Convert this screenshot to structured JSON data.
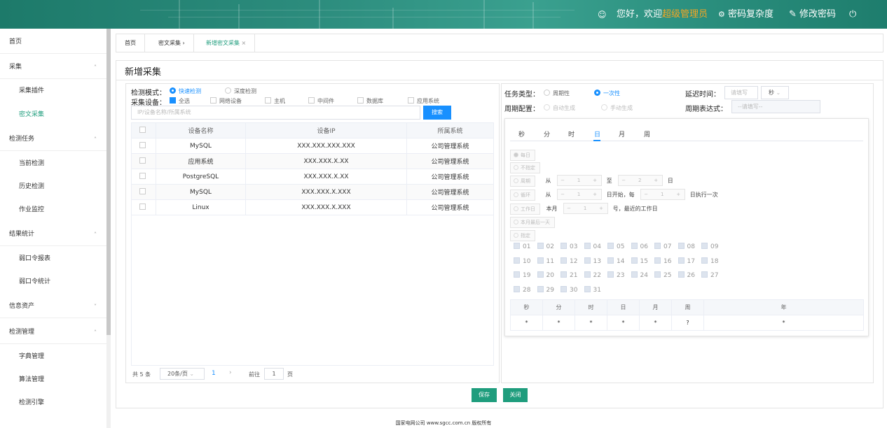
{
  "header": {
    "greeting": "您好，欢迎",
    "user_role": "超级管理员",
    "password_complexity": "密码复杂度",
    "change_password": "修改密码",
    "accent_color": "#f5a623",
    "icons": [
      "user-icon",
      "gear-icon",
      "edit-icon",
      "power-icon"
    ]
  },
  "sidebar": {
    "items": [
      {
        "label": "首页",
        "level": "top"
      },
      {
        "label": "采集",
        "level": "top",
        "arrow": "^"
      },
      {
        "label": "采集插件",
        "level": "sub"
      },
      {
        "label": "密文采集",
        "level": "sub",
        "active": true
      },
      {
        "label": "检测任务",
        "level": "top",
        "arrow": "^"
      },
      {
        "label": "当前检测",
        "level": "sub"
      },
      {
        "label": "历史检测",
        "level": "sub"
      },
      {
        "label": "作业监控",
        "level": "sub"
      },
      {
        "label": "结果统计",
        "level": "top",
        "arrow": "^"
      },
      {
        "label": "弱口令报表",
        "level": "sub"
      },
      {
        "label": "弱口令统计",
        "level": "sub"
      },
      {
        "label": "信息资产",
        "level": "top",
        "arrow": "v"
      },
      {
        "label": "检测管理",
        "level": "top",
        "arrow": "^"
      },
      {
        "label": "字典管理",
        "level": "sub"
      },
      {
        "label": "算法管理",
        "level": "sub"
      },
      {
        "label": "检测引擎",
        "level": "sub"
      }
    ],
    "active_color": "#1f9d7d"
  },
  "tabs": {
    "home": "首页",
    "cipher": "密文采集",
    "cipher_sep": "›",
    "new": "新增密文采集",
    "close": "×"
  },
  "panel": {
    "title": "新增采集"
  },
  "left": {
    "mode_label": "检测模式：",
    "mode_fast": "快速检测",
    "mode_deep": "深度检测",
    "device_label": "采集设备：",
    "device_options": [
      "全选",
      "网络设备",
      "主机",
      "中间件",
      "数据库",
      "应用系统"
    ],
    "search_placeholder": "IP/设备名称/所属系统",
    "search_button": "搜索",
    "table": {
      "headers": [
        "设备名称",
        "设备IP",
        "所属系统"
      ],
      "rows": [
        [
          "MySQL",
          "XXX.XXX.XXX.XXX",
          "公司管理系统"
        ],
        [
          "应用系统",
          "XXX.XXX.X.XX",
          "公司管理系统"
        ],
        [
          "PostgreSQL",
          "XXX.XXX.X.XX",
          "公司管理系统"
        ],
        [
          "MySQL",
          "XXX.XXX.X.XXX",
          "公司管理系统"
        ],
        [
          "Linux",
          "XXX.XXX.X.XXX",
          "公司管理系统"
        ]
      ]
    },
    "pager": {
      "total": "共 5 条",
      "page_size": "20条/页",
      "current": "1",
      "next": "›",
      "goto": "前往",
      "goto_value": "1",
      "page_unit": "页"
    }
  },
  "right": {
    "task_type_label": "任务类型：",
    "task_periodic": "周期性",
    "task_once": "一次性",
    "delay_label": "延迟时间：",
    "delay_placeholder": "请填写",
    "delay_unit": "秒",
    "period_label": "周期配置：",
    "period_auto": "自动生成",
    "period_manual": "手动生成",
    "expr_label": "周期表达式：",
    "expr_placeholder": "--请填写--",
    "cron_tabs": [
      "秒",
      "分",
      "时",
      "日",
      "月",
      "周"
    ],
    "cron_active_tab": "日",
    "opt_daily": "每日",
    "opt_unspecified": "不指定",
    "opt_period": "周期",
    "from": "从",
    "to": "至",
    "day": "日",
    "p_from": "1",
    "p_to": "2",
    "opt_loop": "循环",
    "l_from": "1",
    "l_mid": "日开始，每",
    "l_every": "1",
    "l_end": "日执行一次",
    "opt_workday": "工作日",
    "w_pre": "本月",
    "w_val": "1",
    "w_post": "号，最近的工作日",
    "opt_lastday": "本月最后一天",
    "opt_specify": "指定",
    "days": [
      "01",
      "02",
      "03",
      "04",
      "05",
      "06",
      "07",
      "08",
      "09",
      "10",
      "11",
      "12",
      "13",
      "14",
      "15",
      "16",
      "17",
      "18",
      "19",
      "20",
      "21",
      "22",
      "23",
      "24",
      "25",
      "26",
      "27",
      "28",
      "29",
      "30",
      "31"
    ],
    "summary_headers": [
      "秒",
      "分",
      "时",
      "日",
      "月",
      "周",
      "年"
    ],
    "summary_values": [
      "*",
      "*",
      "*",
      "*",
      "*",
      "?",
      "*"
    ]
  },
  "actions": {
    "save": "保存",
    "close": "关闭"
  },
  "footer": {
    "text": "国家电网公司 www.sgcc.com.cn 版权所有"
  }
}
